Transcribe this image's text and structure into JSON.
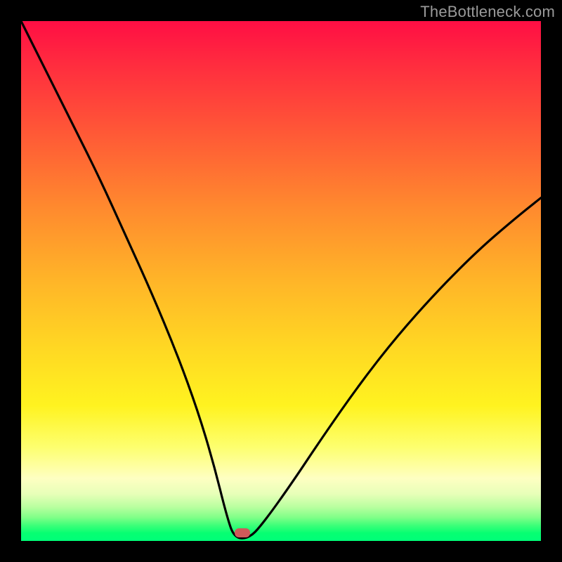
{
  "watermark": "TheBottleneck.com",
  "marker": {
    "x_frac": 0.425,
    "y_frac": 0.985
  },
  "colors": {
    "frame": "#000000",
    "curve": "#000000",
    "marker": "#cf5a5a",
    "watermark": "#9a9a9a",
    "gradient_stops": [
      "#ff0e44",
      "#ff2b3f",
      "#ff5a36",
      "#ff8a2e",
      "#ffb528",
      "#ffd823",
      "#fff320",
      "#fdff6f",
      "#feffc2",
      "#e7ffb8",
      "#b8ff9f",
      "#7fff88",
      "#3dff79",
      "#06ff72",
      "#00ff78"
    ]
  },
  "chart_data": {
    "type": "line",
    "title": "",
    "xlabel": "",
    "ylabel": "",
    "xlim": [
      0,
      1
    ],
    "ylim": [
      0,
      1
    ],
    "note": "Axes are unlabeled; values are fractional positions in the plot area. Curve is a V-shaped bottleneck curve with minimum near x≈0.42 at y≈0.",
    "series": [
      {
        "name": "bottleneck-curve",
        "x": [
          0.0,
          0.05,
          0.1,
          0.15,
          0.2,
          0.25,
          0.3,
          0.34,
          0.37,
          0.395,
          0.41,
          0.44,
          0.47,
          0.52,
          0.58,
          0.65,
          0.72,
          0.8,
          0.88,
          0.95,
          1.0
        ],
        "y": [
          1.0,
          0.9,
          0.8,
          0.7,
          0.59,
          0.48,
          0.36,
          0.25,
          0.15,
          0.05,
          0.005,
          0.005,
          0.04,
          0.11,
          0.2,
          0.3,
          0.39,
          0.48,
          0.56,
          0.62,
          0.66
        ]
      }
    ],
    "marker_point": {
      "x": 0.425,
      "y": 0.015,
      "label": ""
    }
  }
}
